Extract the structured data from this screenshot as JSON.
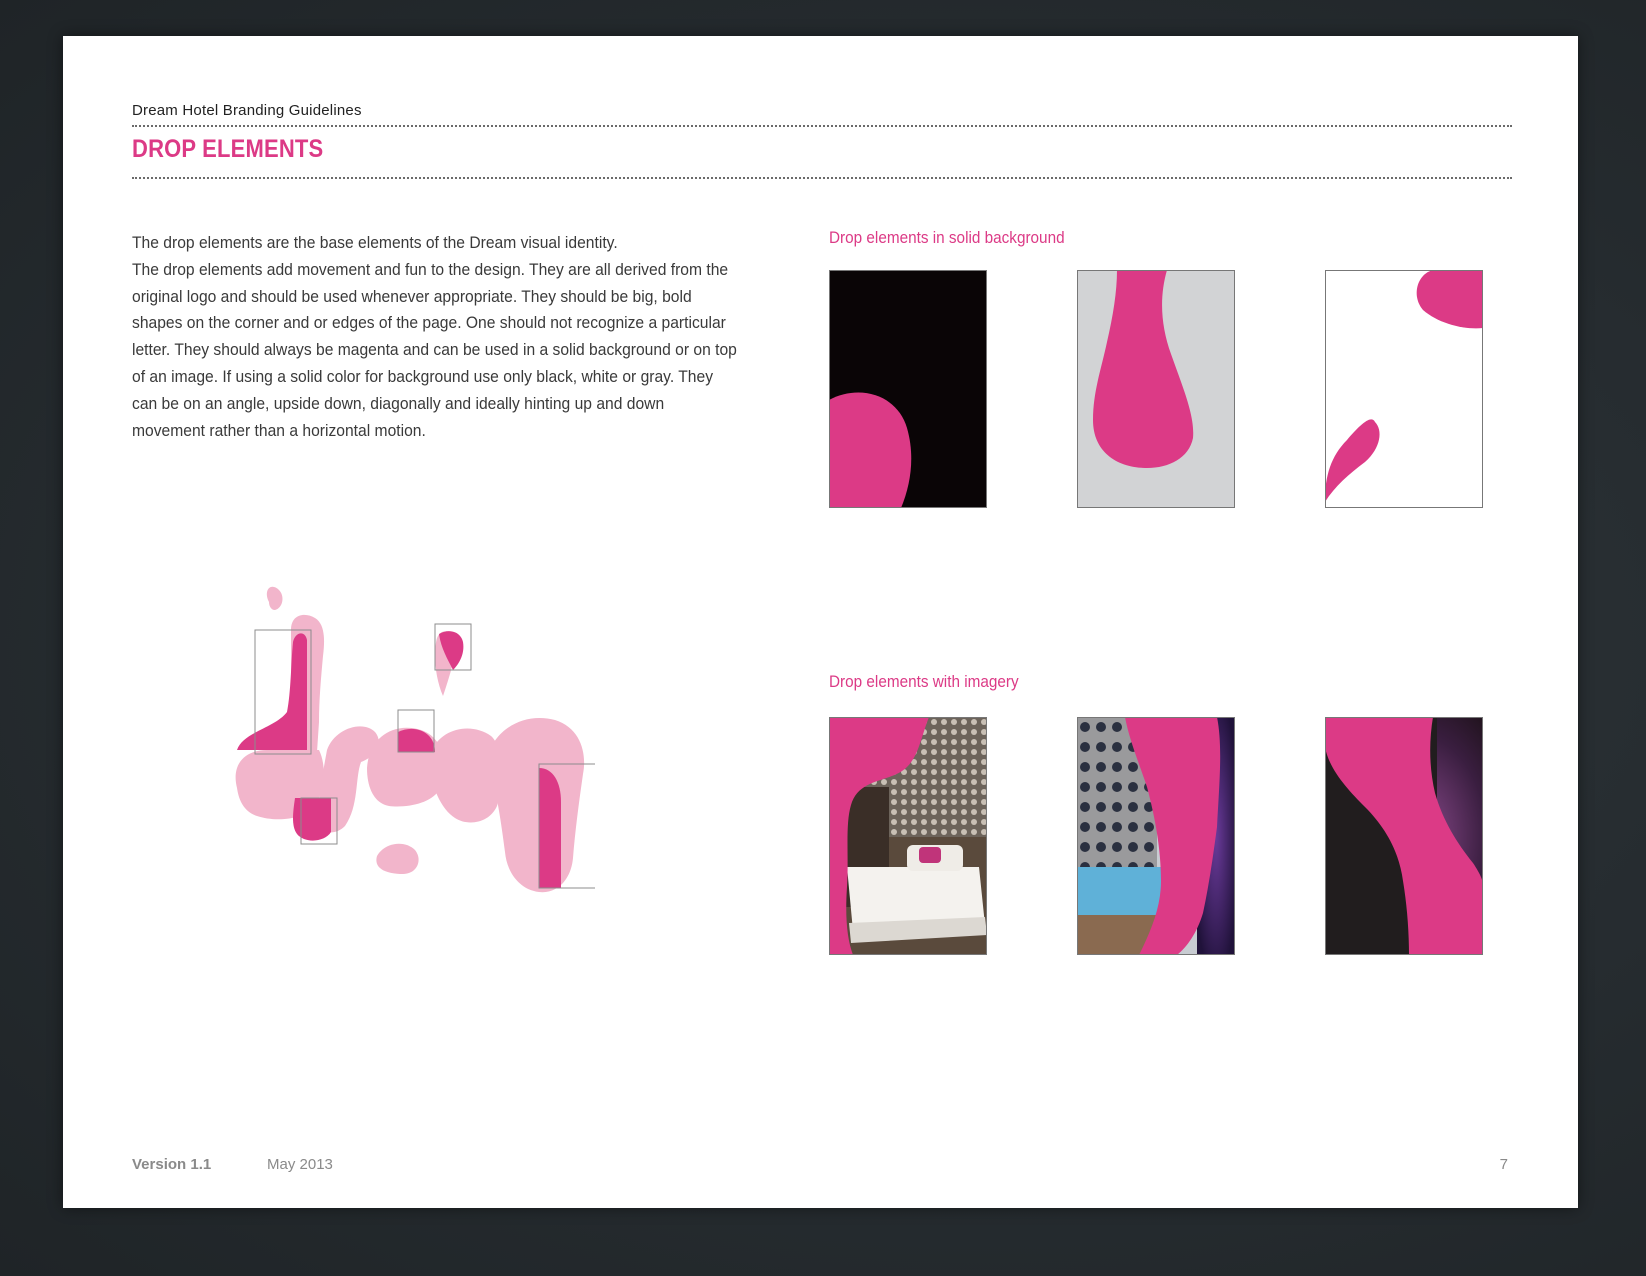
{
  "header": {
    "doc_title": "Dream Hotel Branding Guidelines",
    "section_title": "DROP ELEMENTS"
  },
  "body": {
    "paragraph_1": "The drop elements are the base elements of the Dream visual identity.",
    "paragraph_2": "The drop elements add movement and fun to the design. They are all derived from the original logo and should be used whenever appropriate. They should be big, bold shapes on the corner and or edges of the page. One should not recognize a particular letter. They should always be magenta and can be used in a solid background or on top of an image. If using a solid color for background use only black, white or gray. They can be on an angle, upside down, diagonally and ideally hinting up and down movement rather than a horizontal motion."
  },
  "logo_art": {
    "wordmark": "dream",
    "colors": {
      "light_pink": "#f2b5cb",
      "magenta": "#dc3a86"
    }
  },
  "panels": {
    "solid_caption": "Drop elements in solid background",
    "imagery_caption": "Drop elements with imagery",
    "solid_tiles": [
      {
        "background": "black",
        "background_color": "#0a0506"
      },
      {
        "background": "gray",
        "background_color": "#d2d3d5"
      },
      {
        "background": "white",
        "background_color": "#ffffff"
      }
    ],
    "imagery_tiles": [
      {
        "image": "hotel-bedroom-photo"
      },
      {
        "image": "hotel-pool-building-photo"
      },
      {
        "image": "dark-glitter-photo"
      }
    ]
  },
  "colors": {
    "accent_magenta": "#dc3a86",
    "text_gray": "#3a3a3a"
  },
  "footer": {
    "version": "Version 1.1",
    "date": "May 2013",
    "page_number": "7"
  }
}
